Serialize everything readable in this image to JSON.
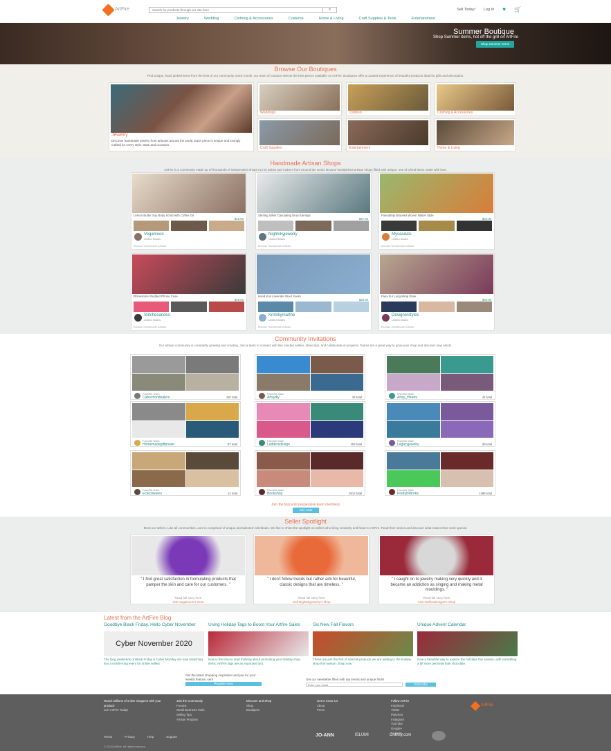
{
  "header": {
    "logo": "ArtFire",
    "search_placeholder": "Search for products through our site here",
    "sell": "Sell Today!",
    "login": "Log In"
  },
  "nav": [
    "Jewelry",
    "Wedding",
    "Clothing & Accessories",
    "Costume",
    "Home & Living",
    "Craft Supplies & Tools",
    "Entertainment"
  ],
  "hero": {
    "title": "Summer Boutique",
    "subtitle": "Shop Summer items, hot off the grill on ArtFire",
    "cta": "Shop Summer Items"
  },
  "boutiques": {
    "title": "Browse Our Boutiques",
    "desc": "Find unique, hand picked items from the best of our community. Each month, our team of curators selects the best pieces available on ArtFire. Boutiques offer a curated experience of beautiful products ideal for gifts and decoration.",
    "big": {
      "label": "Jewelry",
      "text": "Discover handmade jewelry from artisans around the world. Each piece is unique and lovingly crafted for every style, taste and occasion."
    },
    "tiles": [
      "Weddings",
      "Children",
      "Clothing & Accessories",
      "Craft Supplies",
      "Entertainment",
      "Home & Living"
    ],
    "colors": {
      "big": "#7a5344",
      "t0": "#c9b9a8",
      "t1": "#8a7058",
      "t2": "#a9804f",
      "t3": "#8e8a76",
      "t4": "#7a5a44",
      "t5": "#6b4a3a"
    }
  },
  "artisan": {
    "title": "Handmade Artisan Shops",
    "desc": "ArtFire is a community made up of thousands of independent shops run by artists and makers from around the world. Browse handpicked artisan shops filled with unique, one of a kind items made with love.",
    "cards": [
      {
        "title": "Lemon Butter Soy Body Scrub with Coffee Oil",
        "price": "$12.00",
        "shop": "Vegamoon",
        "loc": "United States",
        "footer": "Browse Handmade Artisan",
        "c": [
          "#e8dccb",
          "#8a7062",
          "#b59a7a",
          "#6e5a4a",
          "#c9ab8c"
        ]
      },
      {
        "title": "Sterling Silver Cascading Drop Earrings",
        "price": "$47.00",
        "shop": "Nightskyjewelry",
        "loc": "United States",
        "footer": "Browse Handmade Artisan",
        "c": [
          "#e9e9e9",
          "#5a7a80",
          "#bfbfbf",
          "#7d6a5a",
          "#a0a0a0"
        ]
      },
      {
        "title": "Friendship Bracelet Woven Native Style",
        "price": "$29.00",
        "shop": "Mysandals",
        "loc": "United States",
        "footer": "Browse Handmade Artisan",
        "c": [
          "#9ab86d",
          "#d87d3a",
          "#3a3a3a",
          "#a68a4a",
          "#333333"
        ]
      },
      {
        "title": "Rhinestone Studded Phone Case",
        "price": "$18.00",
        "shop": "Stitchesandco",
        "loc": "United States",
        "footer": "Browse Handmade Artisan",
        "c": [
          "#c94a5a",
          "#3a3a3a",
          "#e85a7a",
          "#5a5a5a",
          "#b84a4a"
        ]
      },
      {
        "title": "Hand Knit Lavender Wool Socks",
        "price": "$28.00",
        "shop": "Knitsbymarthe",
        "loc": "United States",
        "footer": "Browse Handmade Artisan",
        "c": [
          "#7a9ab8",
          "#8aaed0",
          "#5a8aa8",
          "#9ab8d0",
          "#b8d0e0"
        ]
      },
      {
        "title": "Faux Fur Long Wrap Stole",
        "price": "$36.00",
        "shop": "Designerstyles",
        "loc": "United States",
        "footer": "Browse Handmade Artisan",
        "c": [
          "#b8a890",
          "#7a3a5a",
          "#2a3a5a",
          "#d8b8a0",
          "#9a8a7a"
        ]
      }
    ]
  },
  "teams": {
    "title": "Community Invitations",
    "desc": "Our artisan community is constantly growing and creating. Join a team to connect with like minded sellers, share tips, and collaborate on projects. Teams are a great way to grow your shop and discover new artists.",
    "fav_label": "Favorite team",
    "items": [
      {
        "name": "Cabochondealers",
        "members": "110 total",
        "c": [
          "#9a9a9a",
          "#7a7a7a",
          "#8a8a7a",
          "#b8b0a0"
        ]
      },
      {
        "name": "Artsydiy",
        "members": "32 total",
        "c": [
          "#3a8ad0",
          "#7a5a4a",
          "#8a7a6a",
          "#3a6a90"
        ]
      },
      {
        "name": "Artsy_Hearts",
        "members": "41 total",
        "c": [
          "#4a7a5a",
          "#3a9a90",
          "#c8a8c8",
          "#7a5a7a"
        ]
      },
      {
        "name": "Homemadegiftpower",
        "members": "57 total",
        "c": [
          "#8a8a8a",
          "#d8a84a",
          "#e8e8e8",
          "#2a5a7a"
        ]
      },
      {
        "name": "Laddersdesign",
        "members": "152 total",
        "c": [
          "#e88ab8",
          "#3a8a7a",
          "#d85a8a",
          "#2a3a7a"
        ]
      },
      {
        "name": "Legacyjewelry",
        "members": "28 total",
        "c": [
          "#4a8ab8",
          "#7a5a9a",
          "#3a7a9a",
          "#8a6ab8"
        ]
      },
      {
        "name": "Eclectiwares",
        "members": "12 total",
        "c": [
          "#c8a878",
          "#5a4a3a",
          "#8a6a4a",
          "#d8c0a0"
        ]
      },
      {
        "name": "Bookshop",
        "members": "3512 total",
        "c": [
          "#8a5a4a",
          "#5a2a2a",
          "#c88a7a",
          "#e8b8a8"
        ]
      },
      {
        "name": "PrettyNWorks",
        "members": "1286 total",
        "c": [
          "#4a7a9a",
          "#6a2a2a",
          "#4ac85a",
          "#d8c0b0"
        ]
      }
    ],
    "join_text": "Join the fast and inexpensive team members",
    "join_btn": "Join now!"
  },
  "spotlight": {
    "title": "Seller Spotlight",
    "desc": "Meet our sellers. Like all communities, ours is comprised of unique and talented individuals. We like to shine the spotlight on sellers who bring creativity and heart to ArtFire. Read their stories and discover what makes their work special.",
    "items": [
      {
        "quote": "\" I find great satisfaction in formulating products that pamper the skin and care for our customers. \"",
        "l1": "Read full story here",
        "l2": "Visit Vegamoon's store",
        "c": [
          "#e8e8e8",
          "#7a3ab8"
        ]
      },
      {
        "quote": "\" I don't follow trends but rather aim for beautiful, classic designs that are timeless. \"",
        "l1": "Read full story here",
        "l2": "Visit Nightskyjewelry's shop",
        "c": [
          "#f0b89a",
          "#e86a3a"
        ]
      },
      {
        "quote": "\" I caught on to jewelry making very quickly and it became an addiction as singing and making metal mouldings. \"",
        "l1": "Read full story here",
        "l2": "Visit Stelliasdesigns's Shop",
        "c": [
          "#9a2a3a",
          "#d8d8d8"
        ]
      }
    ]
  },
  "blog": {
    "title": "Latest from the ArtFire Blog",
    "posts": [
      {
        "title": "Goodbye Black Friday, Hello Cyber November",
        "img_text": "Cyber November 2020",
        "text": "The long weekends of Black Friday & Cyber Monday are now stretching into a month-long event for online sellers.",
        "c": [
          "#e8e8e8"
        ]
      },
      {
        "title": "Using Holiday Tags to Boost Your Artfire Sales",
        "text": "Now is the time to start thinking about promoting your holiday shop items. ArtFire tags are an important tool.",
        "c": [
          "#b82a3a",
          "#e8e8e8"
        ]
      },
      {
        "title": "Six New Fall Flavors",
        "text": "These are just the first of new fall products we are adding to the holiday shop this season. Shop now.",
        "c": [
          "#c84a2a",
          "#6a8a4a"
        ]
      },
      {
        "title": "Unique Advent Calendar",
        "text": "Give a beautiful way to explore the holidays this season, with something a bit more personal than chocolate.",
        "c": [
          "#9a2a3a",
          "#4a7a4a"
        ]
      }
    ]
  },
  "cta": {
    "left_text": "Get the latest shopping inspiration and join for your weekly feature, sent",
    "left_btn": "Register Now",
    "right_text": "Get our newsletter filled with top trends and unique finds!",
    "right_placeholder": "Enter your email",
    "right_btn": "Subscribe"
  },
  "footer": {
    "cols": [
      {
        "head": "Reach millions of online shoppers with your product!",
        "items": [
          "Join ArtFire Today!"
        ]
      },
      {
        "head": "Join the Community",
        "items": [
          "Forums",
          "Small Business Tools",
          "Selling Tips",
          "Artisan Program"
        ]
      },
      {
        "head": "Discover and Shop",
        "items": [
          "Shop",
          "Boutiques"
        ]
      },
      {
        "head": "Get to Know Us",
        "items": [
          "About",
          "Press"
        ]
      },
      {
        "head": "Follow ArtFire",
        "items": [
          "Facebook",
          "Twitter",
          "Pinterest",
          "Instagram",
          "YouTube",
          "Google+",
          "LinkedIn"
        ]
      }
    ],
    "bottom": [
      "Terms",
      "Privacy",
      "Help",
      "Support"
    ],
    "copyright": "© 2020 ArtFire. All rights reserved.",
    "brands": [
      "JO-ANN",
      "ISLUMI",
      "Craftsy.com",
      "logo"
    ]
  }
}
